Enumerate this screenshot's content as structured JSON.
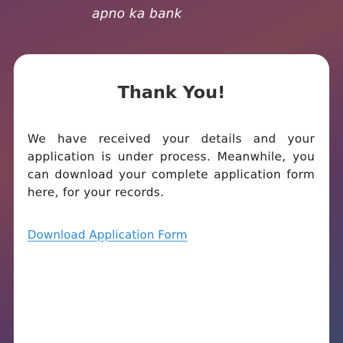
{
  "header": {
    "tagline": "apno ka bank"
  },
  "card": {
    "title": "Thank You!",
    "message": "We have received your details and your application is under process. Meanwhile, you can download your complete application form here, for your records.",
    "download_link": "Download Application Form"
  },
  "colors": {
    "background_gradient_start": "#7b4455",
    "background_gradient_end": "#3f4668",
    "card_background": "#ffffff",
    "title_text": "#333333",
    "link": "#2b8bd6"
  }
}
